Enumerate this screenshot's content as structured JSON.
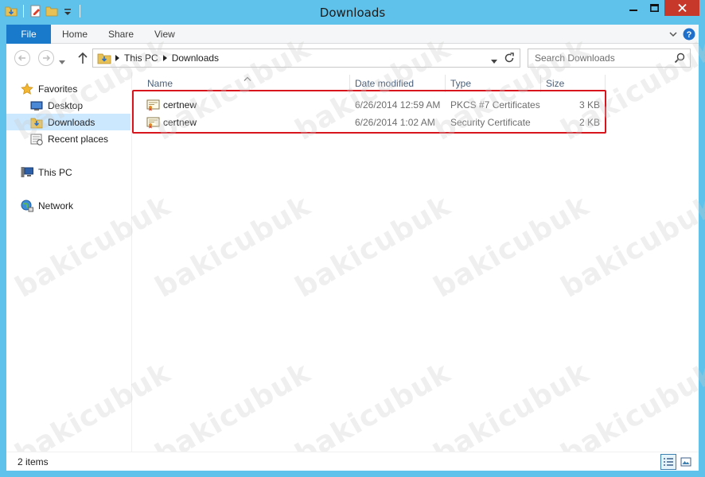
{
  "window": {
    "title": "Downloads"
  },
  "ribbon": {
    "tabs": [
      {
        "label": "File"
      },
      {
        "label": "Home"
      },
      {
        "label": "Share"
      },
      {
        "label": "View"
      }
    ]
  },
  "address": {
    "segments": [
      "This PC",
      "Downloads"
    ]
  },
  "search": {
    "placeholder": "Search Downloads"
  },
  "navpane": {
    "favorites": "Favorites",
    "desktop": "Desktop",
    "downloads": "Downloads",
    "recent": "Recent places",
    "thispc": "This PC",
    "network": "Network"
  },
  "columns": {
    "name": "Name",
    "date": "Date modified",
    "type": "Type",
    "size": "Size"
  },
  "files": [
    {
      "name": "certnew",
      "date": "6/26/2014 12:59 AM",
      "type": "PKCS #7 Certificates",
      "size": "3 KB"
    },
    {
      "name": "certnew",
      "date": "6/26/2014 1:02 AM",
      "type": "Security Certificate",
      "size": "2 KB"
    }
  ],
  "status": {
    "count": "2 items"
  },
  "watermark": {
    "text": "bakicubuk"
  },
  "colors": {
    "titlebar": "#5fc2eb",
    "file_tab": "#1979ca",
    "close_button": "#c7382b",
    "selection": "#cce8ff",
    "highlight_box": "#d8141c"
  }
}
